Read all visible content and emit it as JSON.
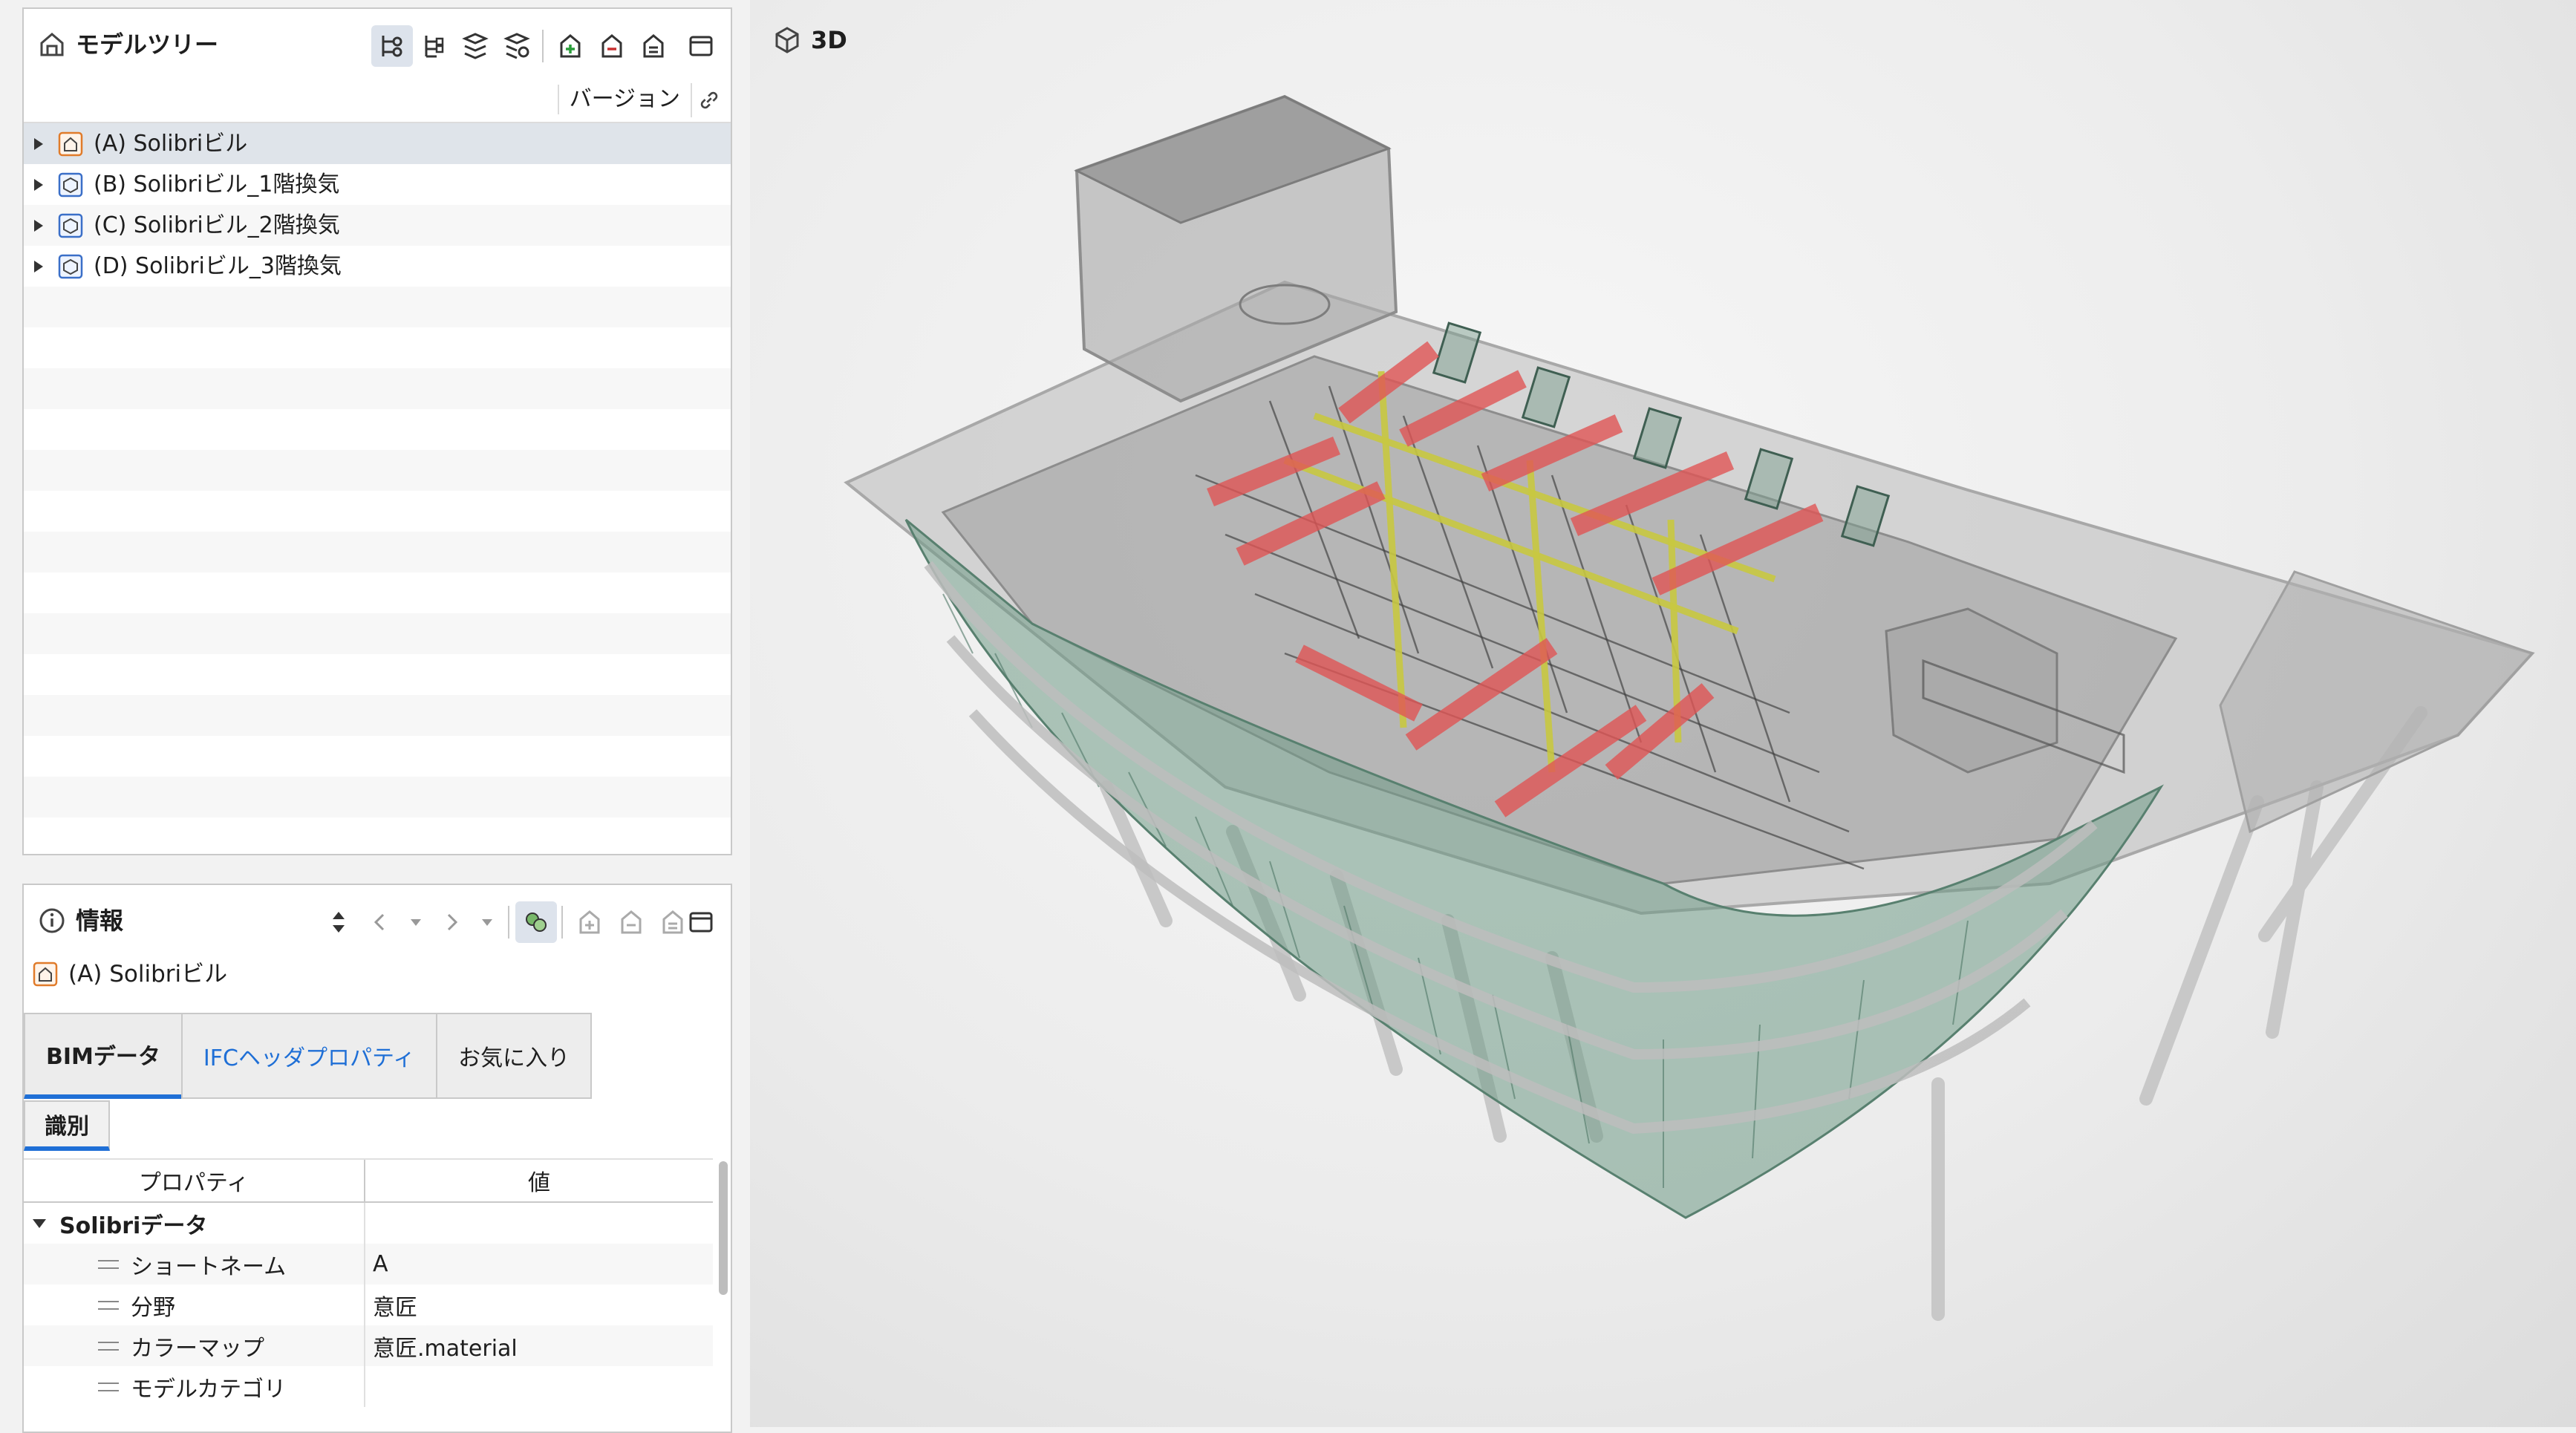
{
  "model_tree": {
    "title": "モデルツリー",
    "version_label": "バージョン",
    "items": [
      {
        "label": "(A) Solibriビル",
        "selected": true
      },
      {
        "label": "(B) Solibriビル_1階換気",
        "selected": false
      },
      {
        "label": "(C) Solibriビル_2階換気",
        "selected": false
      },
      {
        "label": "(D) Solibriビル_3階換気",
        "selected": false
      }
    ]
  },
  "info": {
    "title": "情報",
    "selected_model": "(A) Solibriビル",
    "tabs": [
      {
        "label": "BIMデータ",
        "active": true
      },
      {
        "label": "IFCヘッダプロパティ",
        "active": false
      },
      {
        "label": "お気に入り",
        "active": false
      }
    ],
    "subtabs": [
      {
        "label": "識別",
        "active": true
      }
    ],
    "table": {
      "headers": [
        "プロパティ",
        "値"
      ],
      "groups": [
        {
          "name": "Solibriデータ",
          "rows": [
            {
              "property": "ショートネーム",
              "value": "A"
            },
            {
              "property": "分野",
              "value": "意匠"
            },
            {
              "property": "カラーマップ",
              "value": "意匠.material"
            },
            {
              "property": "モデルカテゴリ",
              "value": ""
            }
          ]
        }
      ]
    }
  },
  "view3d": {
    "title": "3D"
  },
  "colors": {
    "accent": "#1f6fd6",
    "duct": "#e05555",
    "pipe": "#c8c840",
    "glass": "#7fa898",
    "model_icon": "#e07b2a"
  }
}
